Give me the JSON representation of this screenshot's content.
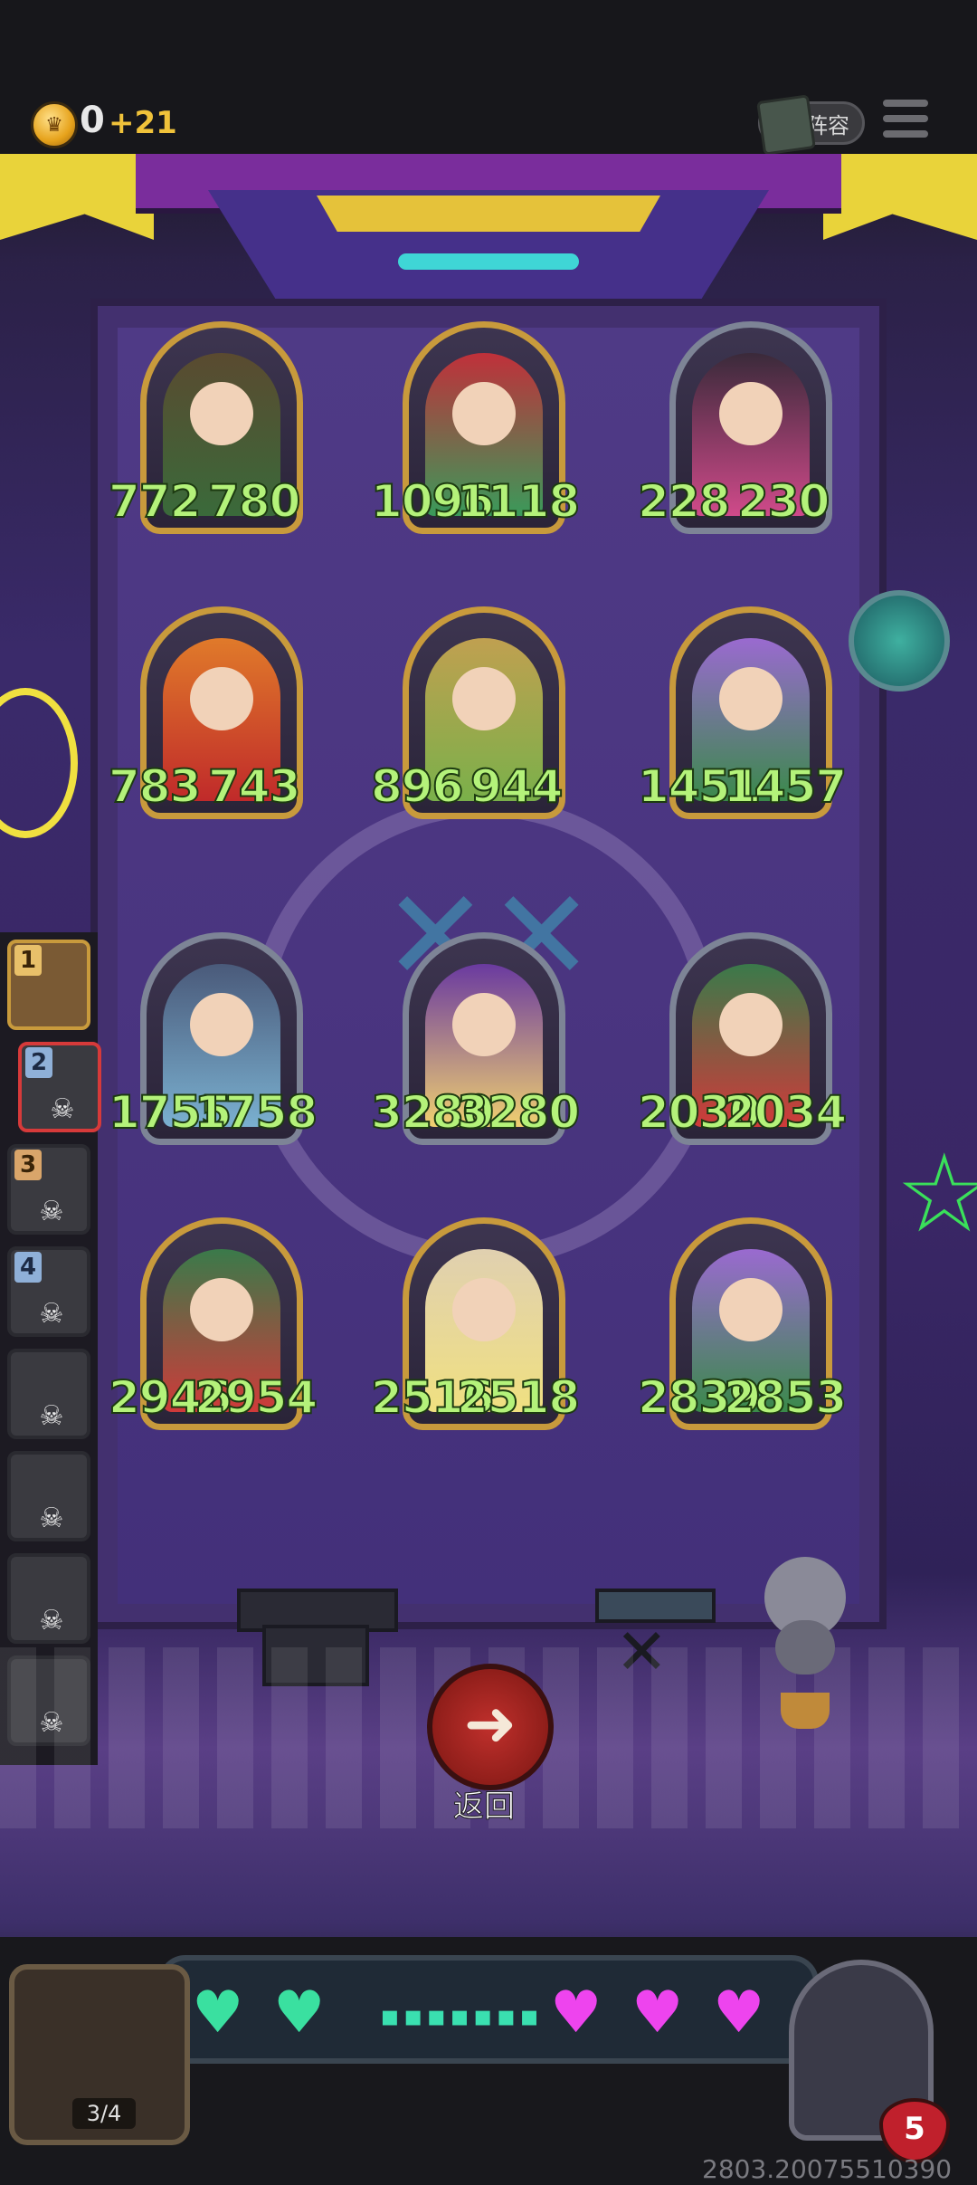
{
  "top": {
    "gold": "0",
    "income": "+21",
    "lineup_label": "阵容"
  },
  "board": {
    "heroes": [
      {
        "name": "treant",
        "attack": "772",
        "health": "780",
        "frame": "gold",
        "colors": [
          "#5a4a30",
          "#3a6a3a"
        ]
      },
      {
        "name": "mushroom-girl",
        "attack": "1096",
        "health": "1118",
        "frame": "gold",
        "colors": [
          "#c0303a",
          "#3a9a5a"
        ]
      },
      {
        "name": "hooded-cultist",
        "attack": "228",
        "health": "230",
        "frame": "silver",
        "colors": [
          "#3a2a3a",
          "#d04a8a"
        ]
      },
      {
        "name": "fire-fairy",
        "attack": "783",
        "health": "743",
        "frame": "gold",
        "colors": [
          "#e07a2a",
          "#c02a2a"
        ]
      },
      {
        "name": "acorn-girl",
        "attack": "896",
        "health": "944",
        "frame": "gold",
        "colors": [
          "#c0a050",
          "#7ab04a"
        ]
      },
      {
        "name": "flower-dryad",
        "attack": "1451",
        "health": "1457",
        "frame": "gold",
        "colors": [
          "#9a6ad0",
          "#3a8a4a"
        ]
      },
      {
        "name": "dark-elf",
        "attack": "1755",
        "health": "1758",
        "frame": "silver",
        "colors": [
          "#4a5a7a",
          "#7ab0d0"
        ]
      },
      {
        "name": "blonde-druid",
        "attack": "3280",
        "health": "3280",
        "frame": "silver",
        "colors": [
          "#6a3aa0",
          "#f0d070"
        ]
      },
      {
        "name": "berry-elf",
        "attack": "2030",
        "health": "2034",
        "frame": "silver",
        "colors": [
          "#3a7a4a",
          "#d03a3a"
        ]
      },
      {
        "name": "berry-elf",
        "attack": "2946",
        "health": "2954",
        "frame": "gold",
        "colors": [
          "#3a7a4a",
          "#d03a3a"
        ]
      },
      {
        "name": "flower-maiden",
        "attack": "2516",
        "health": "2518",
        "frame": "gold",
        "colors": [
          "#e0d0b0",
          "#f0e080"
        ]
      },
      {
        "name": "flower-dryad",
        "attack": "2839",
        "health": "2853",
        "frame": "gold",
        "colors": [
          "#9a6ad0",
          "#3a8a4a"
        ]
      }
    ]
  },
  "bench": {
    "slots": [
      {
        "rank": "1",
        "state": "active"
      },
      {
        "rank": "2",
        "state": "selected"
      },
      {
        "rank": "3",
        "state": "dead"
      },
      {
        "rank": "4",
        "state": "dead"
      },
      {
        "rank": "",
        "state": "dead"
      },
      {
        "rank": "",
        "state": "dead"
      },
      {
        "rank": "",
        "state": "dead"
      },
      {
        "rank": "",
        "state": "dead"
      }
    ]
  },
  "back_button": {
    "label": "返回",
    "icon": "arrow-left-icon"
  },
  "bottom": {
    "player_hearts": 2,
    "opponent_hearts": 3,
    "chest_count": "3/4",
    "opponent_lives": "5",
    "colors": {
      "player_heart": "#3ae0a0",
      "opponent_heart": "#ee44ee"
    }
  },
  "version": "2803.20075510390"
}
